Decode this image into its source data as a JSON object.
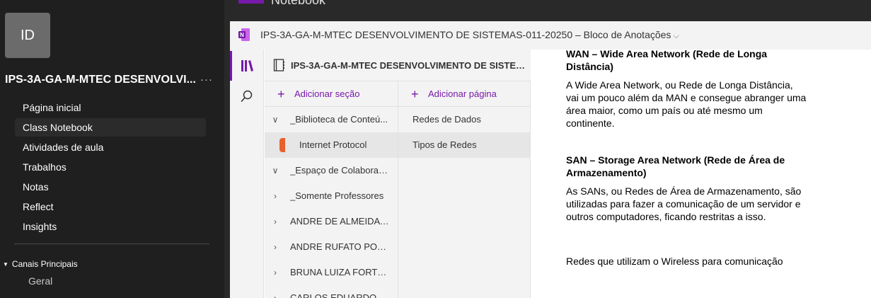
{
  "teams": {
    "avatar_initials": "ID",
    "team_name": "IPS-3A-GA-M-MTEC DESENVOLVI...",
    "more_label": "···",
    "nav": [
      {
        "label": "Página inicial"
      },
      {
        "label": "Class Notebook"
      },
      {
        "label": "Atividades de aula"
      },
      {
        "label": "Trabalhos"
      },
      {
        "label": "Notas"
      },
      {
        "label": "Reflect"
      },
      {
        "label": "Insights"
      }
    ],
    "channels_header": "Canais Principais",
    "channels": [
      {
        "label": "Geral"
      }
    ]
  },
  "tab_header": {
    "title": "Notebook"
  },
  "onenote": {
    "notebook_title": "IPS-3A-GA-M-MTEC DESENVOLVIMENTO DE SISTEMAS-011-20250 – Bloco de Anotações",
    "notebook_header": "IPS-3A-GA-M-MTEC DESENVOLVIMENTO DE SISTEMAS-...",
    "add_section": "Adicionar seção",
    "add_page": "Adicionar página",
    "sections": [
      {
        "label": "_Biblioteca de Conteú...",
        "arrow": "∨"
      },
      {
        "label": "Internet Protocol",
        "arrow": ""
      },
      {
        "label": "_Espaço de Colaboraç...",
        "arrow": "∨"
      },
      {
        "label": "_Somente Professores",
        "arrow": "›"
      },
      {
        "label": "ANDRE DE ALMEIDA ...",
        "arrow": "›"
      },
      {
        "label": "ANDRE RUFATO PORT...",
        "arrow": "›"
      },
      {
        "label": "BRUNA LUIZA FORTE...",
        "arrow": "›"
      },
      {
        "label": "CARLOS EDUARDO P...",
        "arrow": "›"
      }
    ],
    "pages": [
      {
        "label": "Redes de Dados"
      },
      {
        "label": "Tipos de Redes"
      }
    ],
    "accent_color": "#7719aa",
    "section_color": "#e8612c"
  },
  "page_content": {
    "wan_heading": "WAN – Wide Area Network (Rede de Longa Distância)",
    "wan_text": "A Wide Area Network, ou Rede de Longa Distância, vai um pouco além da MAN e consegue abranger uma área maior, como um país ou até mesmo um continente.",
    "san_heading": "SAN – Storage Area Network (Rede de Área de Armazenamento)",
    "san_text": "As SANs, ou Redes de Área de Armazenamento, são utilizadas para fazer a comunicação de um servidor e outros computadores, ficando restritas a isso.",
    "wireless_text": "Redes que utilizam o Wireless para comunicação"
  }
}
